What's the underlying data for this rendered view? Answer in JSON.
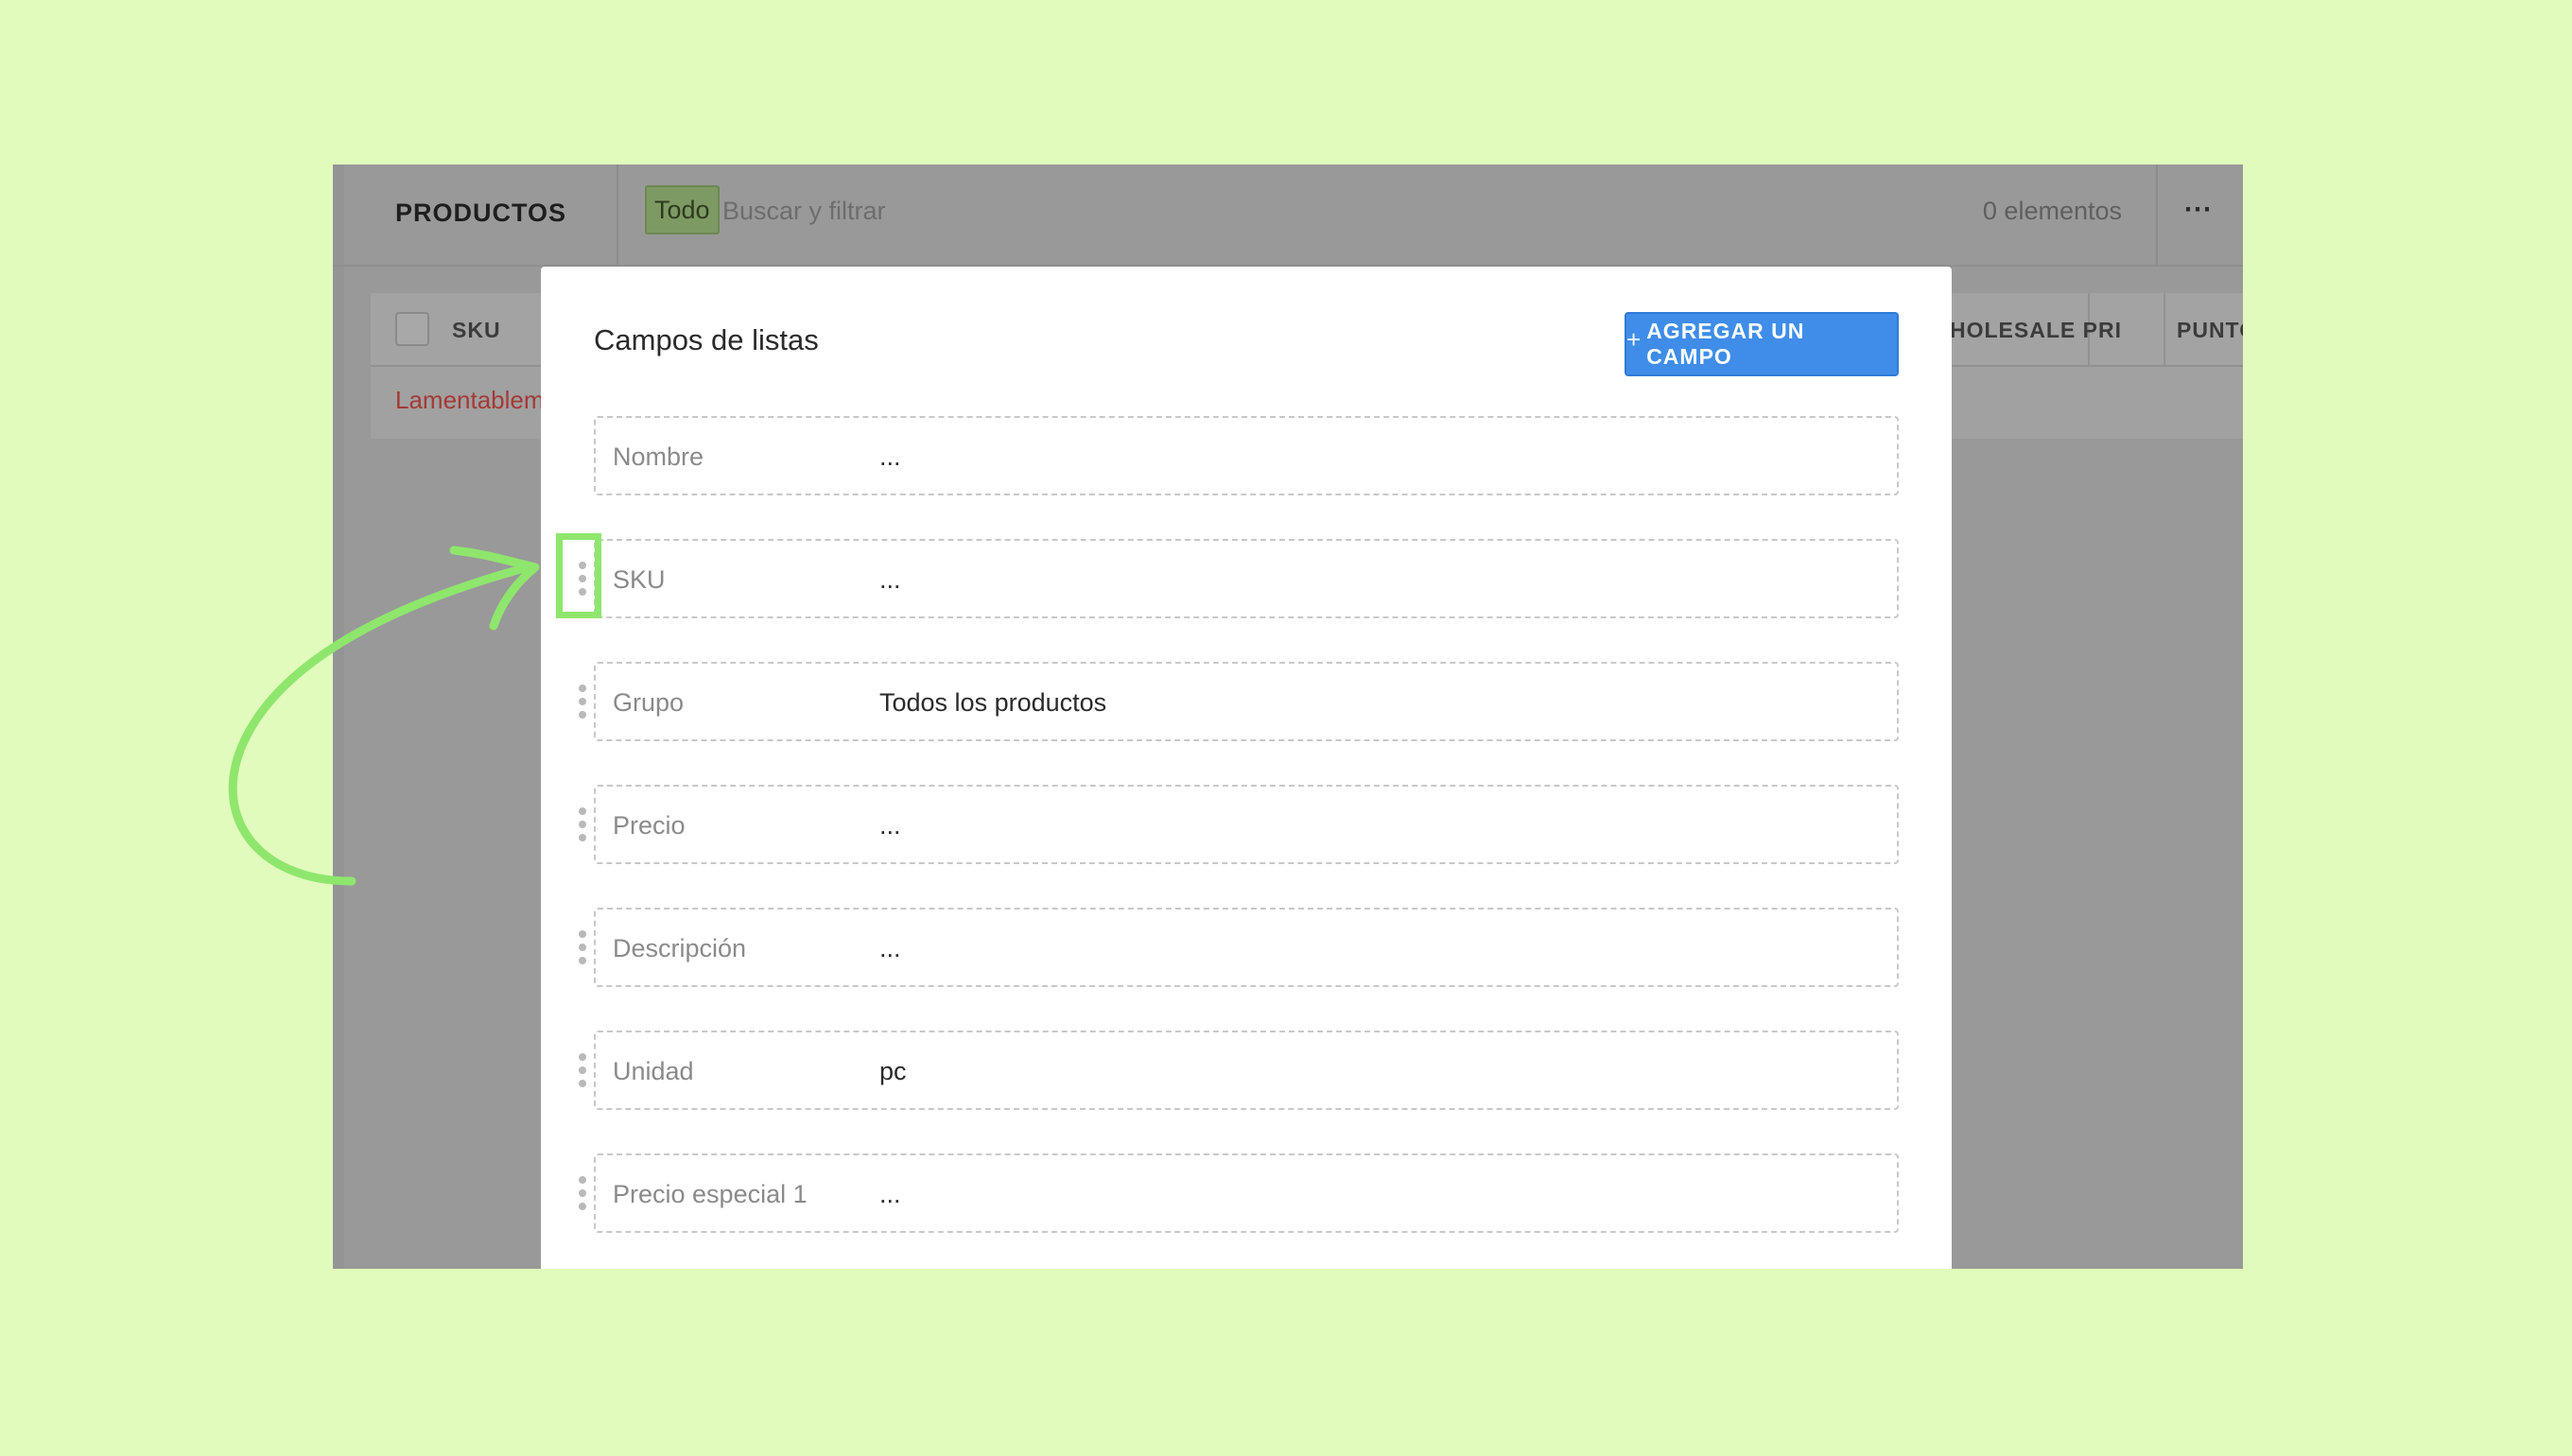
{
  "app": {
    "title": "PRODUCTOS",
    "filter_chip": "Todo",
    "search_placeholder": "Buscar y filtrar",
    "item_count": "0 elementos",
    "more_icon": "more-horizontal-icon",
    "table": {
      "columns": [
        "SKU",
        "HOLESALE PRI",
        "PUNTOS I"
      ],
      "empty_message": "Lamentablem"
    }
  },
  "modal": {
    "title": "Campos de listas",
    "add_button": {
      "icon": "plus-icon",
      "label": "AGREGAR UN CAMPO"
    },
    "fields": [
      {
        "label": "Nombre",
        "value": "...",
        "draggable": false
      },
      {
        "label": "SKU",
        "value": "...",
        "draggable": true
      },
      {
        "label": "Grupo",
        "value": "Todos los productos",
        "draggable": true
      },
      {
        "label": "Precio",
        "value": "...",
        "draggable": true
      },
      {
        "label": "Descripción",
        "value": "...",
        "draggable": true
      },
      {
        "label": "Unidad",
        "value": "pc",
        "draggable": true
      },
      {
        "label": "Precio especial 1",
        "value": "...",
        "draggable": true
      }
    ]
  },
  "annotation": {
    "color": "#8fe66d",
    "highlighted_field": "SKU"
  },
  "colors": {
    "background": "#e0fbbb",
    "overlay": "#999999",
    "accent": "#3f8de8",
    "warning": "#a33a35"
  }
}
